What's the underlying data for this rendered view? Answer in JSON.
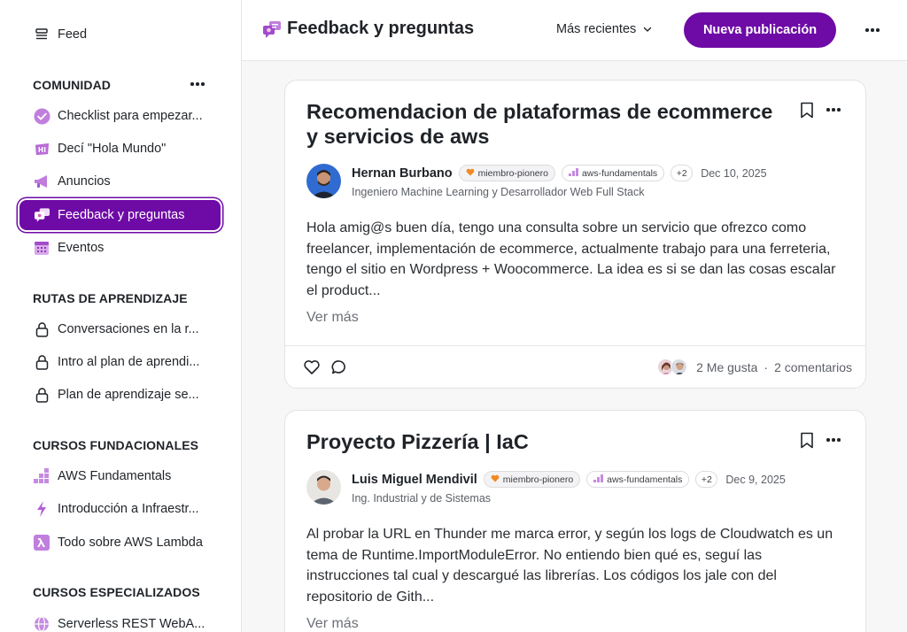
{
  "sidebar": {
    "feed_label": "Feed",
    "sections": {
      "comunidad": "COMUNIDAD",
      "rutas": "RUTAS DE APRENDIZAJE",
      "fundacionales": "CURSOS FUNDACIONALES",
      "especializados": "CURSOS ESPECIALIZADOS"
    },
    "comunidad_items": [
      {
        "label": "Checklist para empezar...",
        "icon": "check-circle-icon"
      },
      {
        "label": "Decí \"Hola Mundo\"",
        "icon": "hi-sign-icon"
      },
      {
        "label": "Anuncios",
        "icon": "megaphone-icon"
      },
      {
        "label": "Feedback y preguntas",
        "icon": "chat-bubbles-icon",
        "active": true
      },
      {
        "label": "Eventos",
        "icon": "calendar-icon"
      }
    ],
    "rutas_items": [
      {
        "label": "Conversaciones en la r...",
        "icon": "lock-icon"
      },
      {
        "label": "Intro al plan de aprendi...",
        "icon": "lock-icon"
      },
      {
        "label": "Plan de aprendizaje se...",
        "icon": "lock-icon"
      }
    ],
    "fundacionales_items": [
      {
        "label": "AWS Fundamentals",
        "icon": "bar-blocks-icon"
      },
      {
        "label": "Introducción a Infraestr...",
        "icon": "lightning-icon"
      },
      {
        "label": "Todo sobre AWS Lambda",
        "icon": "lambda-icon"
      }
    ],
    "especializados_items": [
      {
        "label": "Serverless REST WebA...",
        "icon": "globe-icon"
      }
    ]
  },
  "header": {
    "title": "Feedback y preguntas",
    "sort_label": "Más recientes",
    "new_post_label": "Nueva publicación"
  },
  "posts": [
    {
      "title": "Recomendacion de plataformas de ecommerce y servicios de aws",
      "author": "Hernan Burbano",
      "badge": "miembro-pionero",
      "tag": "aws-fundamentals",
      "extra_tags": "+2",
      "date": "Dec 10, 2025",
      "subtitle": "Ingeniero Machine Learning y Desarrollador Web Full Stack",
      "excerpt": "Hola amig@s buen día, tengo una consulta sobre un servicio que ofrezco como freelancer, implementación de ecommerce, actualmente trabajo para una ferreteria, tengo el sitio en Wordpress + Woocommerce. La idea es si se dan las cosas escalar el product...",
      "read_more": "Ver más",
      "likes": "2 Me gusta",
      "separator": "·",
      "comments": "2 comentarios"
    },
    {
      "title": "Proyecto Pizzería | IaC",
      "author": "Luis Miguel Mendivil",
      "badge": "miembro-pionero",
      "tag": "aws-fundamentals",
      "extra_tags": "+2",
      "date": "Dec 9, 2025",
      "subtitle": "Ing. Industrial y de Sistemas",
      "excerpt": "Al probar la URL en Thunder me marca error, y según los logs de Cloudwatch es un tema de  Runtime.ImportModuleError. No entiendo bien qué es, seguí las instrucciones tal cual y descargué las librerías. Los códigos los jale con del repositorio de Gith...",
      "read_more": "Ver más"
    }
  ],
  "colors": {
    "accent": "#6e0aa6",
    "icon_purple": "#b05fd6",
    "badge_orange": "#f08a24"
  }
}
